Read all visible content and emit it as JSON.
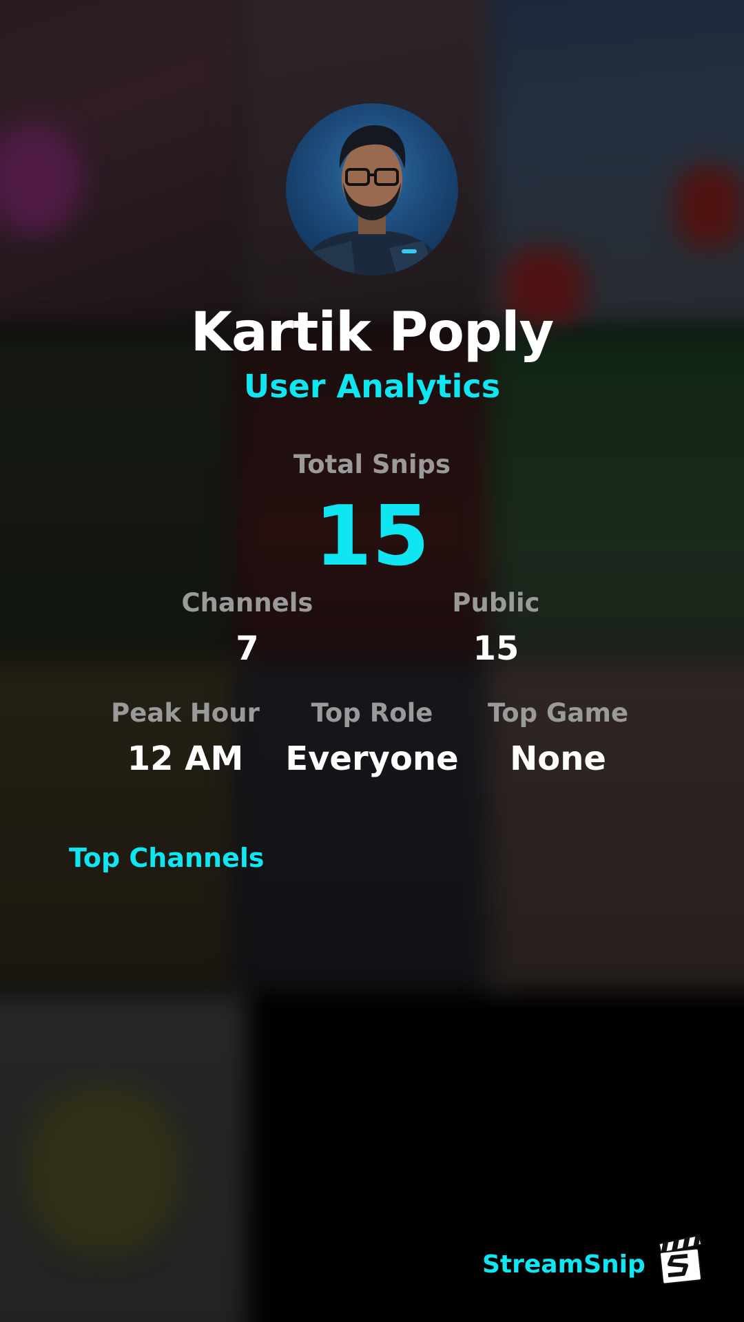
{
  "profile": {
    "name": "Kartik Poply",
    "subtitle": "User Analytics"
  },
  "stats": {
    "total_snips": {
      "label": "Total Snips",
      "value": "15"
    },
    "channels": {
      "label": "Channels",
      "value": "7"
    },
    "public": {
      "label": "Public",
      "value": "15"
    },
    "peak_hour": {
      "label": "Peak Hour",
      "value": "12 AM"
    },
    "top_role": {
      "label": "Top Role",
      "value": "Everyone"
    },
    "top_game": {
      "label": "Top Game",
      "value": "None"
    }
  },
  "sections": {
    "top_channels_heading": "Top Channels"
  },
  "branding": {
    "name": "StreamSnip",
    "logo_icon": "clapperboard-icon"
  },
  "colors": {
    "accent": "#10e6f2",
    "label": "#9a9a9a",
    "value": "#ffffff",
    "background": "#000000"
  }
}
